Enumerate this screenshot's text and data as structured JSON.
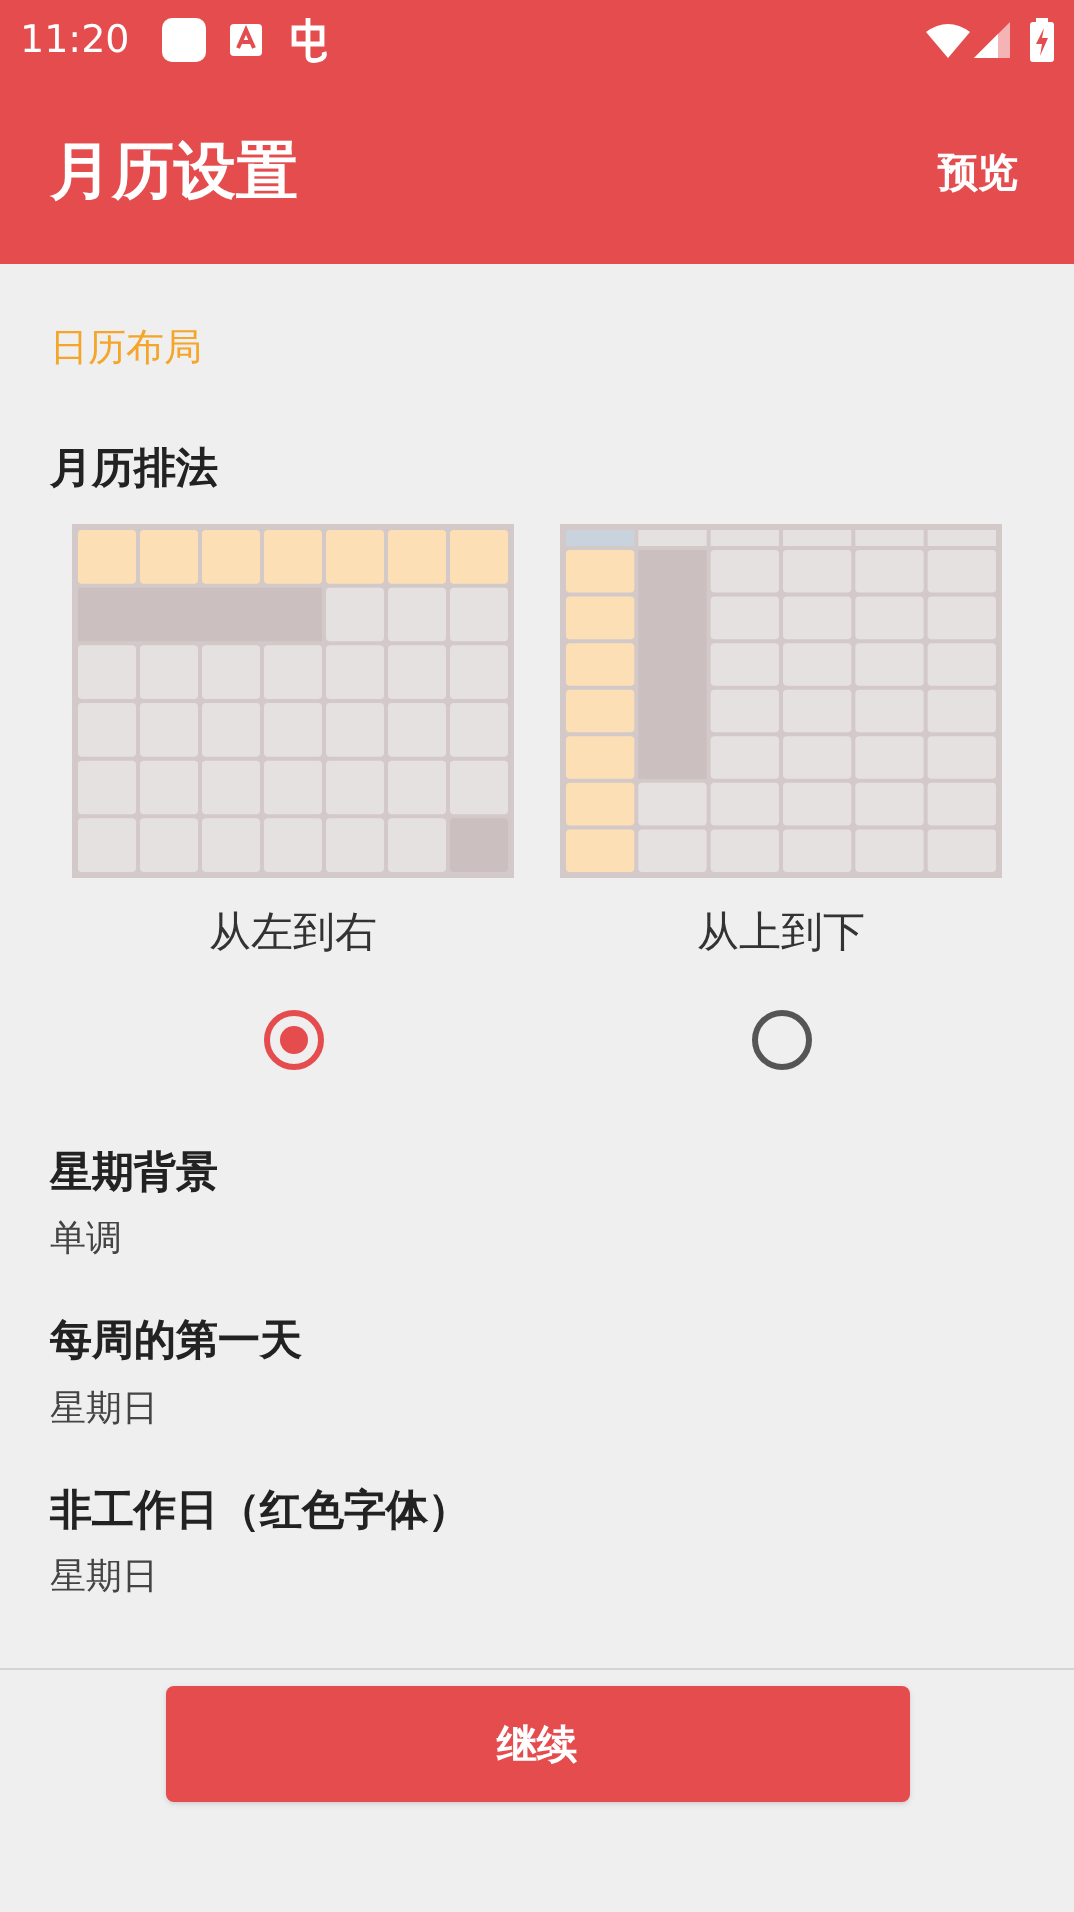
{
  "status_bar": {
    "time": "11:20"
  },
  "app_bar": {
    "title": "月历设置",
    "action": "预览"
  },
  "section": {
    "label": "日历布局"
  },
  "layout": {
    "title": "月历排法",
    "options": [
      {
        "kind": "horizontal",
        "label": "从左到右",
        "selected": true
      },
      {
        "kind": "vertical",
        "label": "从上到下",
        "selected": false
      }
    ]
  },
  "items": [
    {
      "title": "星期背景",
      "value": "单调"
    },
    {
      "title": "每周的第一天",
      "value": "星期日"
    },
    {
      "title": "非工作日（红色字体）",
      "value": "星期日"
    }
  ],
  "button": {
    "label": "继续"
  }
}
